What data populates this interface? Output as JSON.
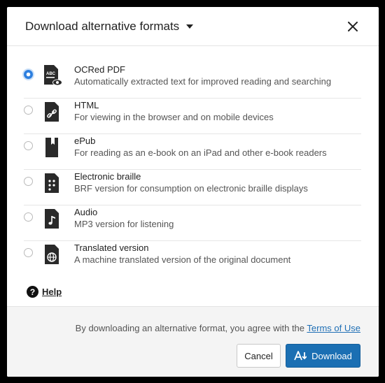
{
  "dialog": {
    "title": "Download alternative formats",
    "close_icon": "close-icon"
  },
  "formats": [
    {
      "name": "OCRed PDF",
      "description": "Automatically extracted text for improved reading and searching",
      "icon": "ocr-pdf-icon",
      "selected": true
    },
    {
      "name": "HTML",
      "description": "For viewing in the browser and on mobile devices",
      "icon": "html-link-icon",
      "selected": false
    },
    {
      "name": "ePub",
      "description": "For reading as an e-book on an iPad and other e-book readers",
      "icon": "epub-book-icon",
      "selected": false
    },
    {
      "name": "Electronic braille",
      "description": "BRF version for consumption on electronic braille displays",
      "icon": "braille-icon",
      "selected": false
    },
    {
      "name": "Audio",
      "description": "MP3 version for listening",
      "icon": "audio-note-icon",
      "selected": false
    },
    {
      "name": "Translated version",
      "description": "A machine translated version of the original document",
      "icon": "globe-icon",
      "selected": false
    }
  ],
  "help": {
    "label": "Help",
    "icon": "question-circle-icon"
  },
  "footer": {
    "agreement_text": "By downloading an alternative format, you agree with the",
    "terms_link": "Terms of Use",
    "cancel_label": "Cancel",
    "download_label": "Download"
  },
  "colors": {
    "accent": "#1b6fb3",
    "radio_checked": "#2d7fdf",
    "link": "#1f6fb5"
  }
}
